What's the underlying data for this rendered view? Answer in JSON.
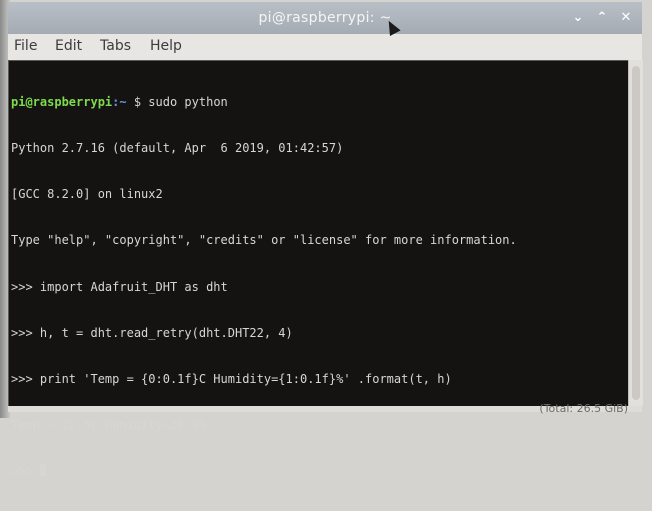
{
  "window": {
    "title": "pi@raspberrypi: ~",
    "controls": {
      "minimize": "⌄",
      "maximize": "⌃",
      "close": "✕"
    }
  },
  "menubar": {
    "items": [
      "File",
      "Edit",
      "Tabs",
      "Help"
    ]
  },
  "terminal": {
    "prompt_user": "pi@raspberrypi",
    "prompt_sep": ":",
    "prompt_path": "~",
    "prompt_end": " $ sudo python",
    "lines": [
      "Python 2.7.16 (default, Apr  6 2019, 01:42:57)",
      "[GCC 8.2.0] on linux2",
      "Type \"help\", \"copyright\", \"credits\" or \"license\" for more information.",
      ">>> import Adafruit_DHT as dht",
      ">>> h, t = dht.read_retry(dht.DHT22, 4)",
      ">>> print 'Temp = {0:0.1f}C Humidity={1:0.1f}%' .format(t, h)",
      "Temp = 25.5C Humidity=28.8%"
    ],
    "current_prompt": ">>> "
  },
  "status": {
    "text": "(Total: 26.5 GiB)"
  }
}
